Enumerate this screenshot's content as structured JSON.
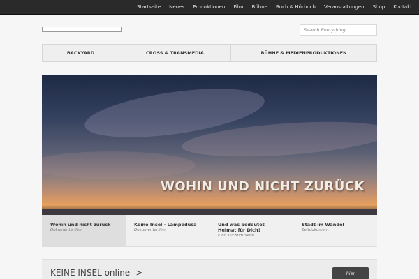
{
  "topnav": [
    "Startseite",
    "Neues",
    "Produktionen",
    "Film",
    "Bühne",
    "Buch & Hörbuch",
    "Veranstaltungen",
    "Shop",
    "Kontakt"
  ],
  "search": {
    "placeholder": "Search Everything"
  },
  "catnav": [
    "BACKYARD",
    "CROSS & TRANSMEDIA",
    "BÜHNE & MEDIENPRODUKTIONEN"
  ],
  "hero": {
    "title": "WOHIN UND NICHT ZURÜCK"
  },
  "slides": [
    {
      "title": "Wohin und nicht zurück",
      "subtitle": "Dokumentarfilm",
      "active": true
    },
    {
      "title": "Keine Insel - Lampedusa",
      "subtitle": "Dokumentarfilm",
      "active": false
    },
    {
      "title": "Und was bedeutet Heimat für Dich?",
      "subtitle": "Kino Kurzfilm Serie",
      "active": false
    },
    {
      "title": "Stadt im Wandel",
      "subtitle": "Zeitdokument",
      "active": false
    }
  ],
  "promo": {
    "text": "KEINE INSEL online ->",
    "button": "hier"
  }
}
